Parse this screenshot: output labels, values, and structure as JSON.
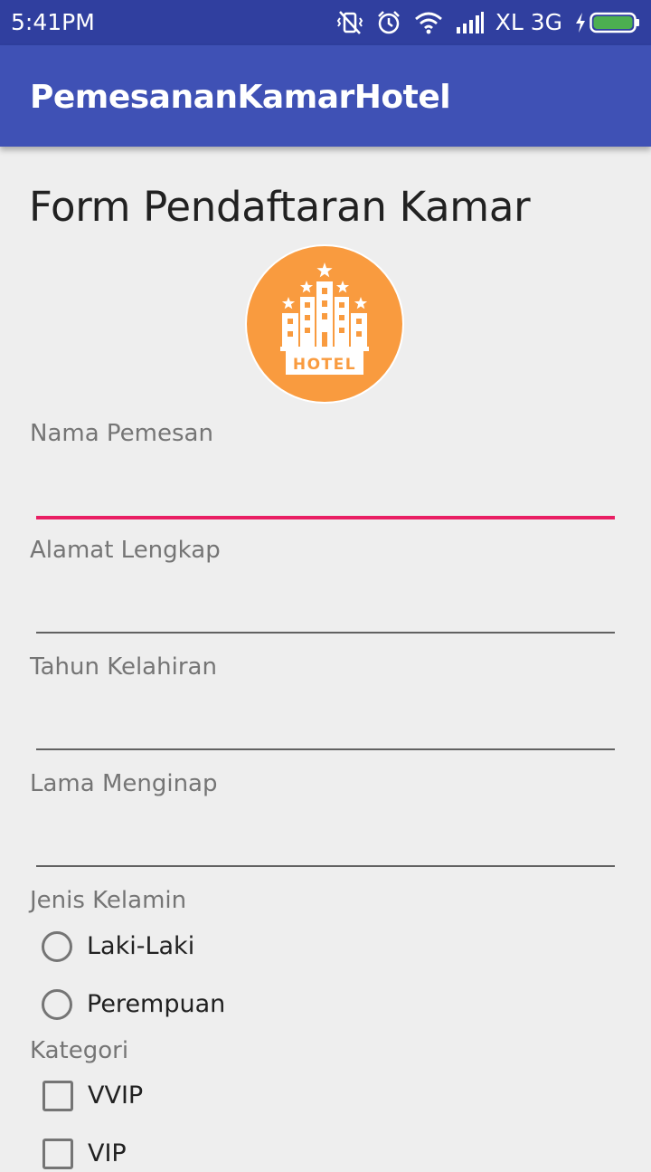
{
  "status_bar": {
    "time": "5:41PM",
    "network": "XL 3G",
    "icons": [
      "vibrate-off-icon",
      "alarm-icon",
      "wifi-icon",
      "signal-icon",
      "charging-icon",
      "battery-icon"
    ],
    "battery_color": "#4caf50"
  },
  "app_bar": {
    "title": "PemesananKamarHotel",
    "color": "#3f51b5",
    "status_color": "#303f9f"
  },
  "form": {
    "heading": "Form Pendaftaran Kamar",
    "logo": {
      "text": "HOTEL",
      "icon": "hotel-building-icon",
      "color": "#f99b3f"
    },
    "fields": {
      "nama": {
        "label": "Nama Pemesan",
        "value": ""
      },
      "alamat": {
        "label": "Alamat Lengkap",
        "value": ""
      },
      "tahun": {
        "label": "Tahun Kelahiran",
        "value": ""
      },
      "lama": {
        "label": "Lama Menginap",
        "value": ""
      }
    },
    "accent_color": "#e91e63",
    "gender": {
      "label": "Jenis Kelamin",
      "options": [
        "Laki-Laki",
        "Perempuan"
      ]
    },
    "category": {
      "label": "Kategori",
      "options": [
        "VVIP",
        "VIP"
      ]
    }
  }
}
